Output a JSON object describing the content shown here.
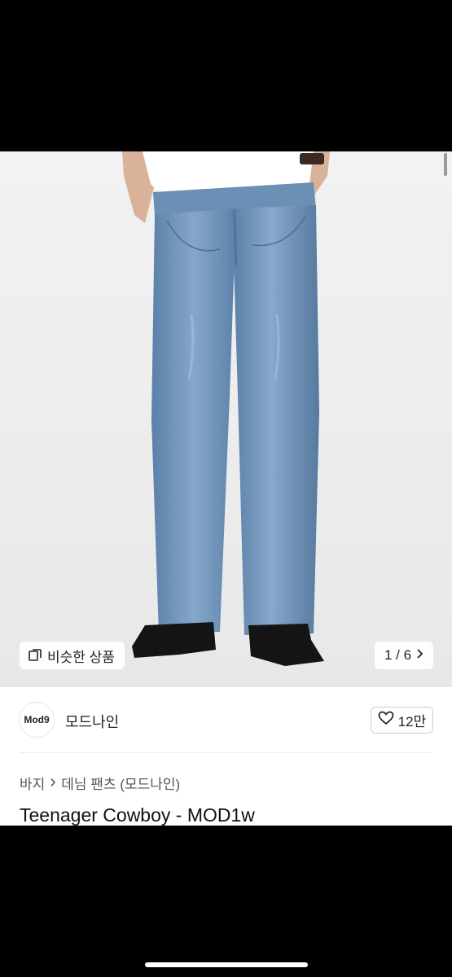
{
  "similar_button": {
    "label": "비슷한 상품",
    "icon": "similar-items-icon"
  },
  "image_counter": {
    "text": "1 / 6",
    "icon": "chevron-right-icon"
  },
  "brand": {
    "logo_text": "Mod9",
    "name": "모드나인"
  },
  "like": {
    "count": "12만",
    "icon": "heart-icon"
  },
  "breadcrumb": {
    "category": "바지",
    "subcategory": "데님 팬츠 (모드나인)"
  },
  "product": {
    "title": "Teenager Cowboy - MOD1w"
  },
  "colors": {
    "denim": "#6f93b8",
    "background": "#efefef",
    "text": "#222222"
  }
}
